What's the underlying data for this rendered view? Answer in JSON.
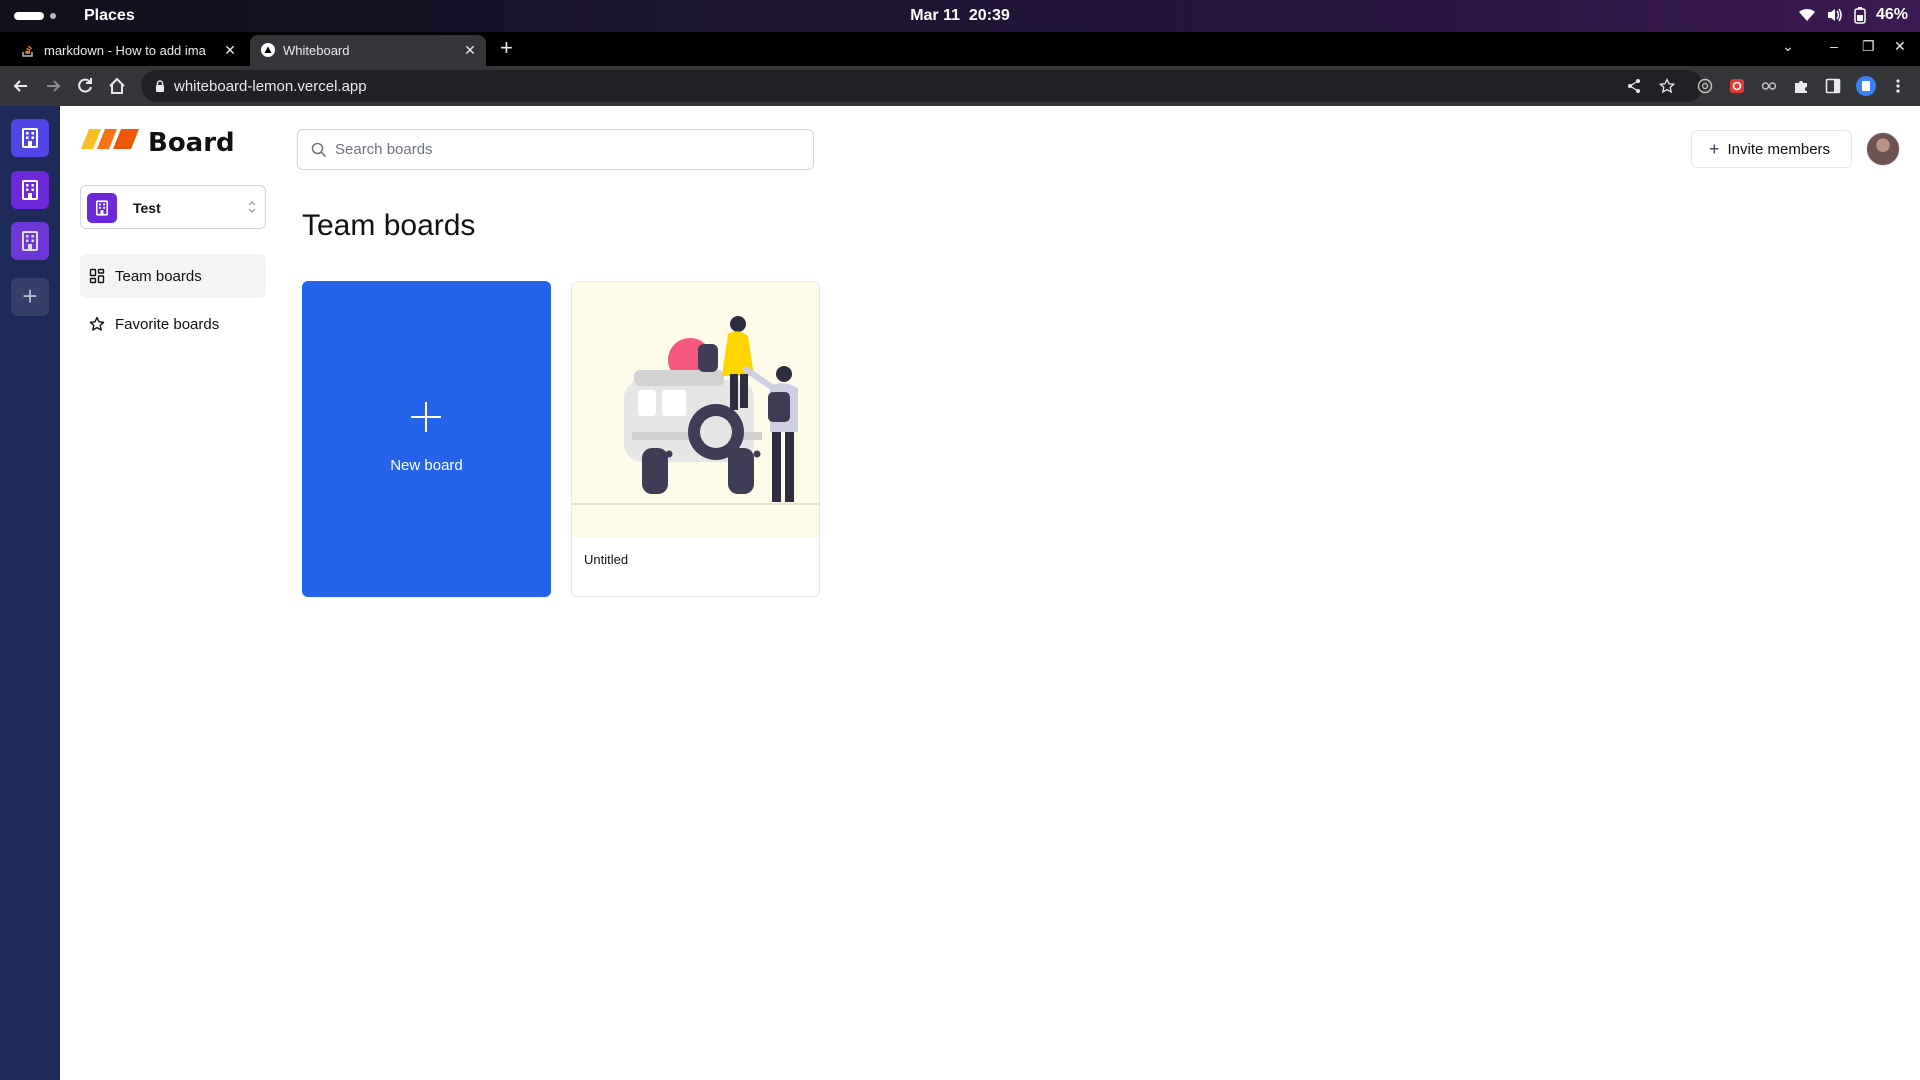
{
  "os_topbar": {
    "activities": "Activities",
    "places_label": "Places",
    "date": "Mar 11",
    "time": "20:39",
    "battery": "46%"
  },
  "browser": {
    "tabs": [
      {
        "title": "markdown - How to add ima",
        "favicon": "stackoverflow-icon",
        "active": false
      },
      {
        "title": "Whiteboard",
        "favicon": "vercel-icon",
        "active": true
      }
    ],
    "url": "whiteboard-lemon.vercel.app",
    "extensions": [
      "chatgpt-extension-icon",
      "ublock-extension-icon",
      "glasses-extension-icon",
      "puzzle-extensions-icon",
      "sidepanel-icon",
      "profile-icon"
    ]
  },
  "app": {
    "org_rail": {
      "orgs": [
        "org-1",
        "org-2",
        "org-3"
      ],
      "add": "+"
    },
    "brand": {
      "name": "Board",
      "colors": [
        "#f59e0b",
        "#f97316",
        "#ea580c"
      ]
    },
    "org_switcher": {
      "name": "Test",
      "color": "#6d28d9"
    },
    "nav": [
      {
        "label": "Team boards",
        "icon": "dashboard-grid-icon",
        "active": true
      },
      {
        "label": "Favorite boards",
        "icon": "star-icon",
        "active": false
      }
    ],
    "search": {
      "placeholder": "Search boards",
      "value": ""
    },
    "invite_label": "Invite members",
    "title": "Team boards",
    "new_board_label": "New board",
    "boards": [
      {
        "title": "Untitled",
        "image": "jeep-travel-illustration"
      }
    ],
    "accent": "#2563eb",
    "rail_color": "#1e2a5a"
  }
}
